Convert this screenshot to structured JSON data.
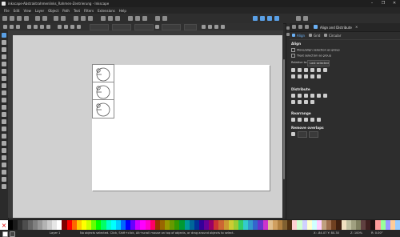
{
  "window": {
    "title": "inkscape-Abstraktrahmenlinks_Rahmen-Zentrierung - Inkscape",
    "controls": [
      "–",
      "❐",
      "✕"
    ]
  },
  "menubar": [
    "File",
    "Edit",
    "View",
    "Layer",
    "Object",
    "Path",
    "Text",
    "Filters",
    "Extensions",
    "Help"
  ],
  "dock": {
    "tab_label": "Align and Distribute",
    "close": "×",
    "subtabs": [
      "Align",
      "Grid",
      "Circular"
    ],
    "align": {
      "heading": "Align",
      "option1": "Move/align selection as group",
      "option2": "Treat selection as group",
      "relative_label": "Relative to:",
      "relative_value": "Last selected"
    },
    "distribute_heading": "Distribute",
    "rearrange_heading": "Rearrange",
    "remove_overlaps_heading": "Remove overlaps"
  },
  "status": {
    "layer": "Layer 1",
    "message": "No objects selected. Click, Shift+click, Alt+scroll mouse on top of objects, or drag around objects to select.",
    "coords": "X: -84.07 Y: 80.30",
    "zoom": "Z: 100%",
    "rotate": "R: 0.00°"
  },
  "palette_colors": [
    "#000000",
    "#1a1a1a",
    "#333333",
    "#4d4d4d",
    "#666666",
    "#808080",
    "#999999",
    "#b3b3b3",
    "#cccccc",
    "#e6e6e6",
    "#ffffff",
    "#800000",
    "#ff0000",
    "#ff6600",
    "#ffcc00",
    "#ffff00",
    "#ccff00",
    "#66ff00",
    "#00ff00",
    "#00ff66",
    "#00ffcc",
    "#00ffff",
    "#00ccff",
    "#0066ff",
    "#0000ff",
    "#6600ff",
    "#cc00ff",
    "#ff00ff",
    "#ff00cc",
    "#ff0066",
    "#993300",
    "#996600",
    "#999900",
    "#669900",
    "#339900",
    "#009933",
    "#009999",
    "#006699",
    "#003399",
    "#330099",
    "#660099",
    "#990066",
    "#cc3333",
    "#cc6633",
    "#cc9933",
    "#cccc33",
    "#99cc33",
    "#33cc66",
    "#33cccc",
    "#3399cc",
    "#3366cc",
    "#6633cc",
    "#cc33cc",
    "#e0c090",
    "#d0a060",
    "#b08040",
    "#806030",
    "#503010",
    "#ffd0d0",
    "#d0ffd0",
    "#d0d0ff",
    "#ffffd0",
    "#d0ffff",
    "#ffd0ff",
    "#c0a080",
    "#a07050",
    "#704020",
    "#402010",
    "#f0e0c0",
    "#c0c0a0",
    "#a0a080",
    "#808060",
    "#604040",
    "#402020",
    "#201010",
    "#ff9999",
    "#99ff99",
    "#9999ff",
    "#ffcc99",
    "#99ccff"
  ]
}
